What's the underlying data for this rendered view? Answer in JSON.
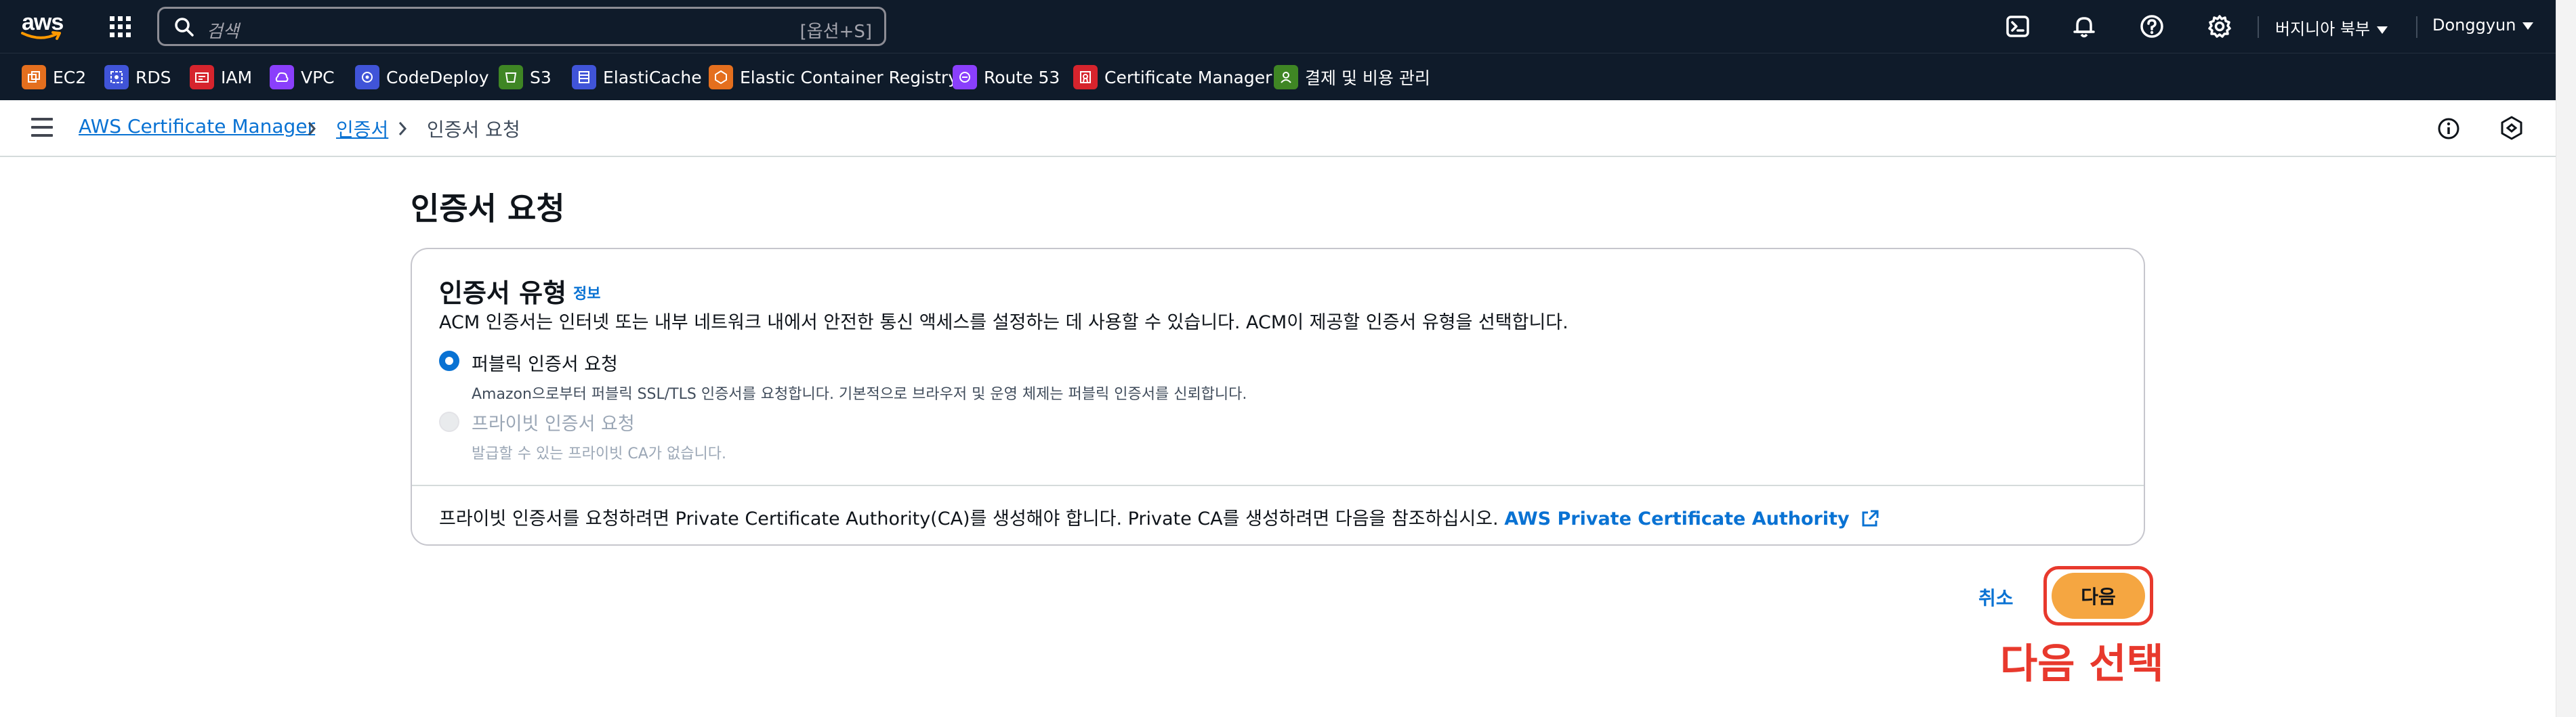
{
  "topnav": {
    "logo_text": "aws",
    "search_placeholder": "검색",
    "search_shortcut": "[옵션+S]",
    "region": "버지니아 북부",
    "user": "Donggyun"
  },
  "favorites": [
    {
      "label": "EC2",
      "color": "#e46f1e",
      "icon": "ec2-icon"
    },
    {
      "label": "RDS",
      "color": "#4054d8",
      "icon": "rds-icon"
    },
    {
      "label": "IAM",
      "color": "#d6242d",
      "icon": "iam-icon"
    },
    {
      "label": "VPC",
      "color": "#8a3ffc",
      "icon": "vpc-icon"
    },
    {
      "label": "CodeDeploy",
      "color": "#4054d8",
      "icon": "codedeploy-icon"
    },
    {
      "label": "S3",
      "color": "#3f8624",
      "icon": "s3-icon"
    },
    {
      "label": "ElastiCache",
      "color": "#4054d8",
      "icon": "elasticache-icon"
    },
    {
      "label": "Elastic Container Registry",
      "color": "#e46f1e",
      "icon": "ecr-icon"
    },
    {
      "label": "Route 53",
      "color": "#8a3ffc",
      "icon": "route53-icon"
    },
    {
      "label": "Certificate Manager",
      "color": "#d6242d",
      "icon": "certificate-manager-icon"
    },
    {
      "label": "결제 및 비용 관리",
      "color": "#3f8624",
      "icon": "billing-icon"
    }
  ],
  "breadcrumb": {
    "items": [
      {
        "label": "AWS Certificate Manager"
      },
      {
        "label": "인증서"
      },
      {
        "label": "인증서 요청"
      }
    ]
  },
  "main": {
    "title": "인증서 요청",
    "panel": {
      "heading": "인증서 유형",
      "info_link": "정보",
      "description": "ACM 인증서는 인터넷 또는 내부 네트워크 내에서 안전한 통신 액세스를 설정하는 데 사용할 수 있습니다. ACM이 제공할 인증서 유형을 선택합니다.",
      "options": [
        {
          "label": "퍼블릭 인증서 요청",
          "sub": "Amazon으로부터 퍼블릭 SSL/TLS 인증서를 요청합니다. 기본적으로 브라우저 및 운영 체제는 퍼블릭 인증서를 신뢰합니다.",
          "selected": true,
          "disabled": false
        },
        {
          "label": "프라이빗 인증서 요청",
          "sub": "발급할 수 있는 프라이빗 CA가 없습니다.",
          "selected": false,
          "disabled": true
        }
      ],
      "footer_text": "프라이빗 인증서를 요청하려면 Private Certificate Authority(CA)를 생성해야 합니다. Private CA를 생성하려면 다음을 참조하십시오.",
      "footer_link": "AWS Private Certificate Authority"
    },
    "cancel_label": "취소",
    "next_label": "다음",
    "annotation": "다음 선택"
  },
  "colors": {
    "nav_bg": "#0f1b2a",
    "link": "#0972d3",
    "primary_button": "#f5a641",
    "annotation_red": "#e8392d"
  }
}
